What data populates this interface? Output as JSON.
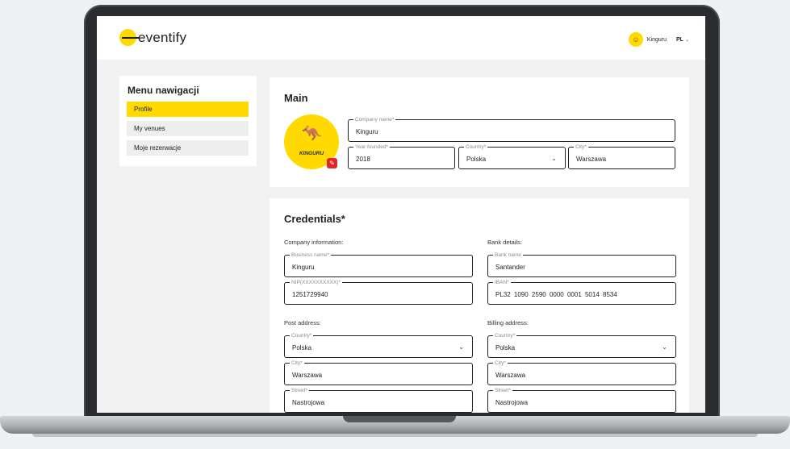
{
  "header": {
    "logo_text": "eventify",
    "user_name": "Kinguru",
    "language": "PL"
  },
  "sidebar": {
    "title": "Menu nawigacji",
    "items": [
      {
        "label": "Profile"
      },
      {
        "label": "My venues"
      },
      {
        "label": "Moje rezerwacje"
      }
    ]
  },
  "main": {
    "title": "Main",
    "avatar_text": "KINGURU",
    "fields": {
      "company_name": {
        "label": "Company name*",
        "value": "Kinguru"
      },
      "year_founded": {
        "label": "Year founded*",
        "value": "2018"
      },
      "country": {
        "label": "Country*",
        "value": "Polska"
      },
      "city": {
        "label": "City*",
        "value": "Warszawa"
      }
    }
  },
  "credentials": {
    "title": "Credentials*",
    "company_info_label": "Company information:",
    "bank_details_label": "Bank details:",
    "post_address_label": "Post address:",
    "billing_address_label": "Billing address:",
    "business_name": {
      "label": "Business name*",
      "value": "Kinguru"
    },
    "nip": {
      "label": "NIP(XXXXXXXXXX)*",
      "value": "1251729940"
    },
    "bank_name": {
      "label": "Bank name",
      "value": "Santander"
    },
    "iban": {
      "label": "IBAN*",
      "value": "PL32 1090 2590 0000 0001 5014 8534"
    },
    "post": {
      "country": {
        "label": "Country*",
        "value": "Polska"
      },
      "city": {
        "label": "City*",
        "value": "Warszawa"
      },
      "street": {
        "label": "Street*",
        "value": "Nastrojowa"
      }
    },
    "billing": {
      "country": {
        "label": "Country*",
        "value": "Polska"
      },
      "city": {
        "label": "City*",
        "value": "Warszawa"
      },
      "street": {
        "label": "Street*",
        "value": "Nastrojowa"
      }
    }
  },
  "colors": {
    "accent": "#ffd900",
    "edit_badge": "#e0262a"
  },
  "icons": {
    "dropdown": "chevron-down-icon",
    "edit": "edit-photo-icon",
    "mascot": "kangaroo-icon"
  }
}
